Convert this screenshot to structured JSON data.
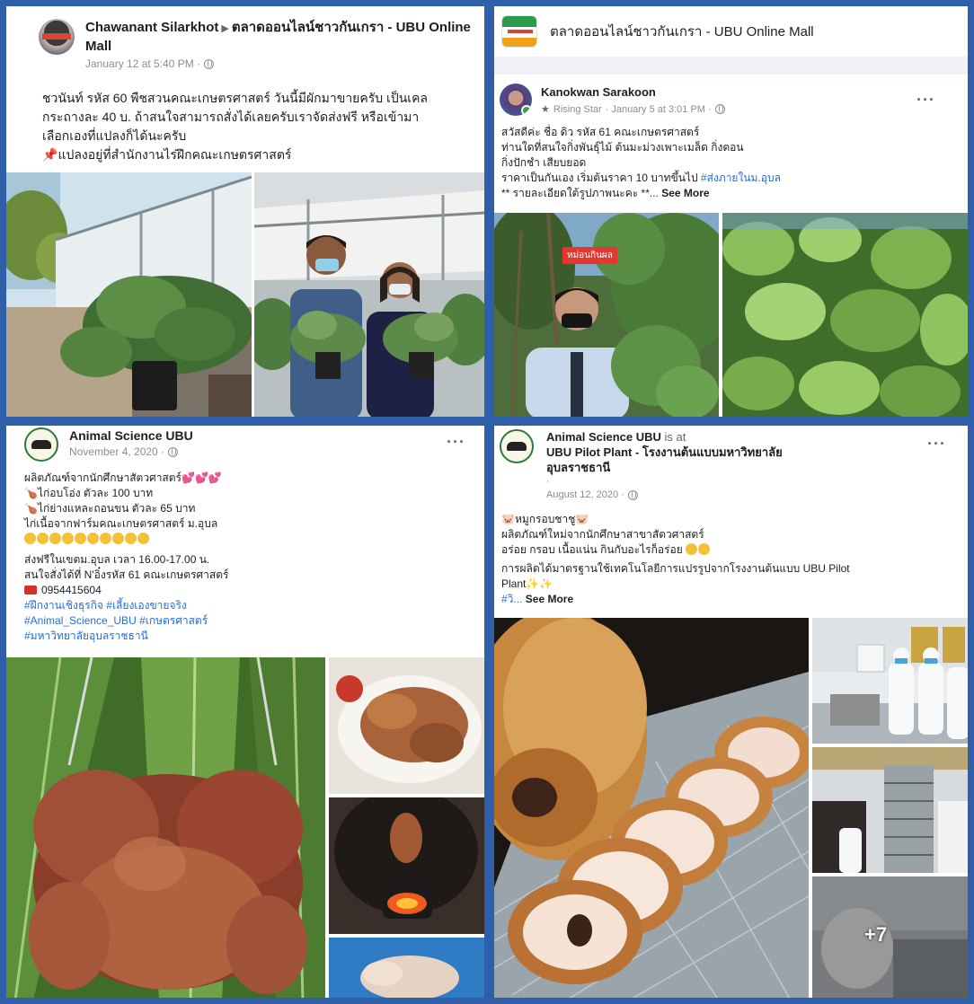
{
  "post1": {
    "author": "Chawanant Silarkhot",
    "arrow": "▶",
    "group": "ตลาดออนไลน์ชาวกันเกรา - UBU Online Mall",
    "timestamp": "January 12 at 5:40 PM ·",
    "lines": [
      "ชวนันท์ รหัส 60 พืชสวนคณะเกษตรศาสตร์ วันนี้มีผักมาขายครับ เป็นเคล",
      "กระถางละ 40 บ. ถ้าสนใจสามารถสั่งได้เลยครับเราจัดส่งฟรี หรือเข้ามา",
      "เลือกเองที่แปลงก็ได้นะครับ"
    ],
    "pin_line": "แปลงอยู่ที่สำนักงานไร่ฝึกคณะเกษตรศาสตร์"
  },
  "post2": {
    "group_header": "ตลาดออนไลน์ชาวกันเกรา - UBU Online Mall",
    "author": "Kanokwan Sarakoon",
    "badge": "Rising Star",
    "timestamp": "· January 5 at 3:01 PM ·",
    "lines": [
      "สวัสดีค่ะ ชื่อ ดิว รหัส 61 คณะเกษตรศาสตร์",
      "ท่านใดที่สนใจกิ่งพันธุ์ไม้ ต้นมะม่วงเพาะเมล็ด กิ่งตอน",
      "กิ่งปักชำ เสียบยอด"
    ],
    "price_prefix": "ราคาเป็นกันเอง เริ่มต้นราคา 10 บาทขึ้นไป ",
    "price_tag": "#ส่งภายในม.อุบล",
    "detail": "** รายละเอียดใต้รูปภาพนะคะ **...",
    "see_more": "See More",
    "photo_label": "หม่อนกินผล"
  },
  "post3": {
    "author": "Animal Science UBU",
    "timestamp": "November 4, 2020 ·",
    "lines": [
      "ผลิตภัณฑ์จากนักศึกษาสัตวศาสตร์",
      "ไก่อบโอ่ง ตัวละ 100 บาท",
      "ไก่ย่างแหละถอนขน ตัวละ 65 บาท",
      "ไก่เนื้อจากฟาร์มคณะเกษตรศาสตร์ ม.อุบล"
    ],
    "delivery_lines": [
      "ส่งฟรีในเขตม.อุบล เวลา 16.00-17.00 น.",
      "สนใจสั่งได้ที่ N'อิ๋งรหัส 61 คณะเกษตรศาสตร์"
    ],
    "phone": "0954415604",
    "hashtags": [
      "#ฝึกงานเชิงธุรกิจ #เลี้ยงเองขายจริง",
      "#Animal_Science_UBU #เกษตรศาสตร์",
      "#มหาวิทยาลัยอุบลราชธานี"
    ]
  },
  "post4": {
    "author": "Animal Science UBU",
    "is_at": "is at",
    "place_line1": "UBU Pilot Plant - โรงงานต้นแบบมหาวิทยาลัย",
    "place_line2": "อุบลราชธานี",
    "timestamp": "August 12, 2020 ·",
    "lines": [
      "หมูกรอบชาชู",
      "ผลิตภัณฑ์ใหม่จากนักศึกษาสาขาสัตวศาสตร์",
      "อร่อย กรอบ เนื้อแน่น กินกับอะไรก็อร่อย"
    ],
    "line_long1": "การผลิตได้มาตรฐานใช้เทคโนโลยีการแปรรูปจากโรงงานต้นแบบ UBU Pilot",
    "line_long2": "Plant",
    "tag": "#วิ...",
    "see_more": "See More",
    "more_count": "+7"
  },
  "colors": {
    "frame": "#2f5fa8",
    "link": "#216fdb"
  }
}
